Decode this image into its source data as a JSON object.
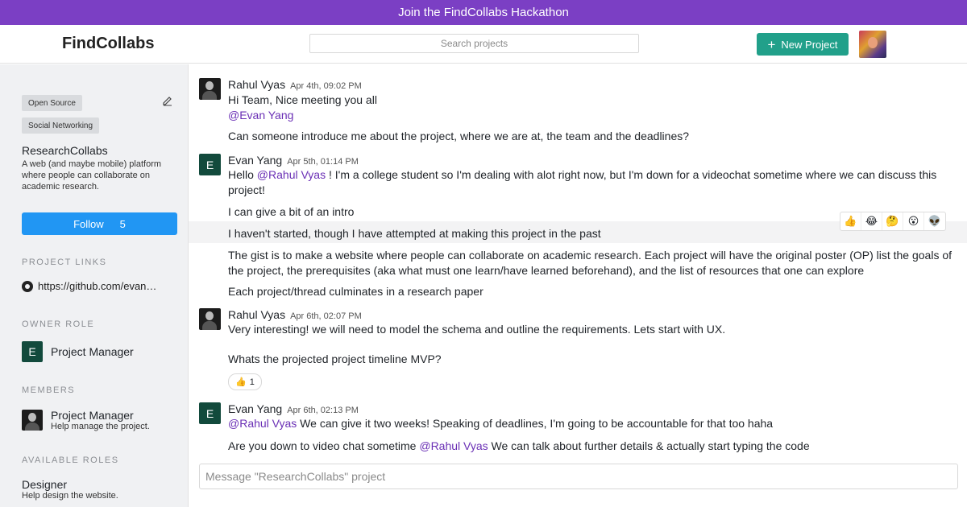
{
  "banner": {
    "text": "Join the FindCollabs Hackathon"
  },
  "header": {
    "logo": "FindCollabs",
    "search_placeholder": "Search projects",
    "new_project_label": "New Project"
  },
  "sidebar": {
    "tags": [
      "Open Source",
      "Social Networking"
    ],
    "project_name": "ResearchCollabs",
    "project_description": "A web (and maybe mobile) platform where people can collaborate on academic research.",
    "follow_label": "Follow",
    "follow_count": "5",
    "links_title": "PROJECT LINKS",
    "link": "https://github.com/evan…",
    "owner_title": "OWNER ROLE",
    "owner": {
      "initial": "E",
      "role": "Project Manager"
    },
    "members_title": "MEMBERS",
    "member": {
      "role": "Project Manager",
      "desc": "Help manage the project."
    },
    "available_title": "AVAILABLE ROLES",
    "available": {
      "role": "Designer",
      "desc": "Help design the website."
    }
  },
  "chat": {
    "messages": [
      {
        "author": "Rahul Vyas",
        "time": "Apr 4th, 09:02 PM",
        "lines": [
          "Hi Team, Nice meeting you all",
          "@Evan Yang",
          "Can someone introduce me about the project, where we are at, the team and the deadlines?"
        ]
      },
      {
        "author": "Evan Yang",
        "initial": "E",
        "time": "Apr 5th, 01:14 PM",
        "lines": [
          "Hello",
          "@Rahul Vyas",
          "! I'm a college student so I'm dealing with alot right now, but I'm down for a videochat sometime where we can discuss this project!",
          "I can give a bit of an intro",
          "I haven't started, though I have attempted at making this project in the past",
          "The gist is to make a website where people can collaborate on academic research. Each project will have the original poster (OP) list the goals of the project, the prerequisites (aka what must one learn/have learned beforehand), and the list of resources that one can explore",
          "Each project/thread culminates in a research paper"
        ]
      },
      {
        "author": "Rahul Vyas",
        "time": "Apr 6th, 02:07 PM",
        "lines": [
          "Very interesting! we will need to model the schema and outline the requirements. Lets start with UX.",
          "Whats the projected project timeline MVP?"
        ],
        "reaction_count": "1"
      },
      {
        "author": "Evan Yang",
        "initial": "E",
        "time": "Apr 6th, 02:13 PM",
        "lines": [
          "@Rahul Vyas",
          " We can give it two weeks! Speaking of deadlines, I'm going to be accountable for that too haha",
          "Are you down to video chat sometime",
          "@Rahul Vyas",
          " We can talk about further details & actually start typing the code"
        ]
      }
    ],
    "reaction_picker": [
      "👍",
      "😂",
      "🤔",
      "😮",
      "👽"
    ],
    "composer_placeholder": "Message \"ResearchCollabs\" project"
  },
  "colors": {
    "banner": "#7b3fc4",
    "new_button": "#21a08a",
    "follow_button": "#2196f3",
    "mention": "#6a2fb5",
    "avatar_e": "#124a3c"
  }
}
